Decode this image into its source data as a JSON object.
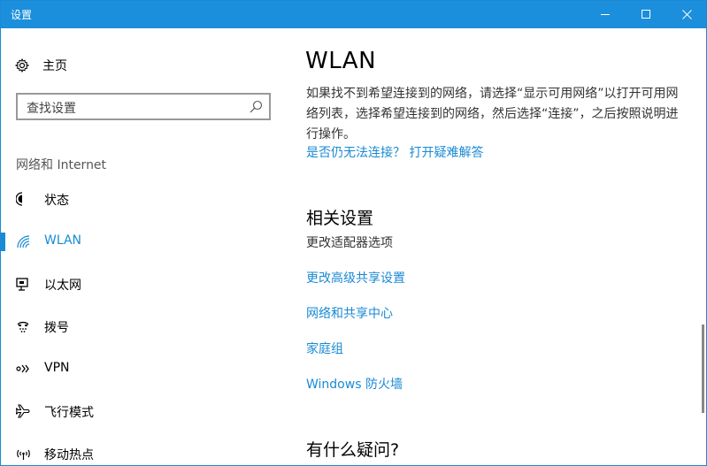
{
  "window": {
    "title": "设置"
  },
  "sidebar": {
    "home_label": "主页",
    "search_placeholder": "查找设置",
    "section_label": "网络和 Internet",
    "items": [
      {
        "label": "状态",
        "icon": "status-icon"
      },
      {
        "label": "WLAN",
        "icon": "wifi-icon",
        "selected": true
      },
      {
        "label": "以太网",
        "icon": "ethernet-icon"
      },
      {
        "label": "拨号",
        "icon": "dialup-icon"
      },
      {
        "label": "VPN",
        "icon": "vpn-icon"
      },
      {
        "label": "飞行模式",
        "icon": "airplane-icon"
      },
      {
        "label": "移动热点",
        "icon": "hotspot-icon"
      }
    ]
  },
  "main": {
    "title": "WLAN",
    "description": "如果找不到希望连接到的网络，请选择“显示可用网络”以打开可用网络列表，选择希望连接到的网络，然后选择“连接”，之后按照说明进行操作。",
    "troubleshoot_link": "是否仍无法连接？ 打开疑难解答",
    "related_heading": "相关设置",
    "adapter_options": "更改适配器选项",
    "related_links": [
      "更改高级共享设置",
      "网络和共享中心",
      "家庭组",
      "Windows 防火墙"
    ],
    "questions_heading": "有什么疑问?"
  },
  "colors": {
    "accent": "#1a8ad4",
    "titlebar": "#1b8fdb"
  }
}
